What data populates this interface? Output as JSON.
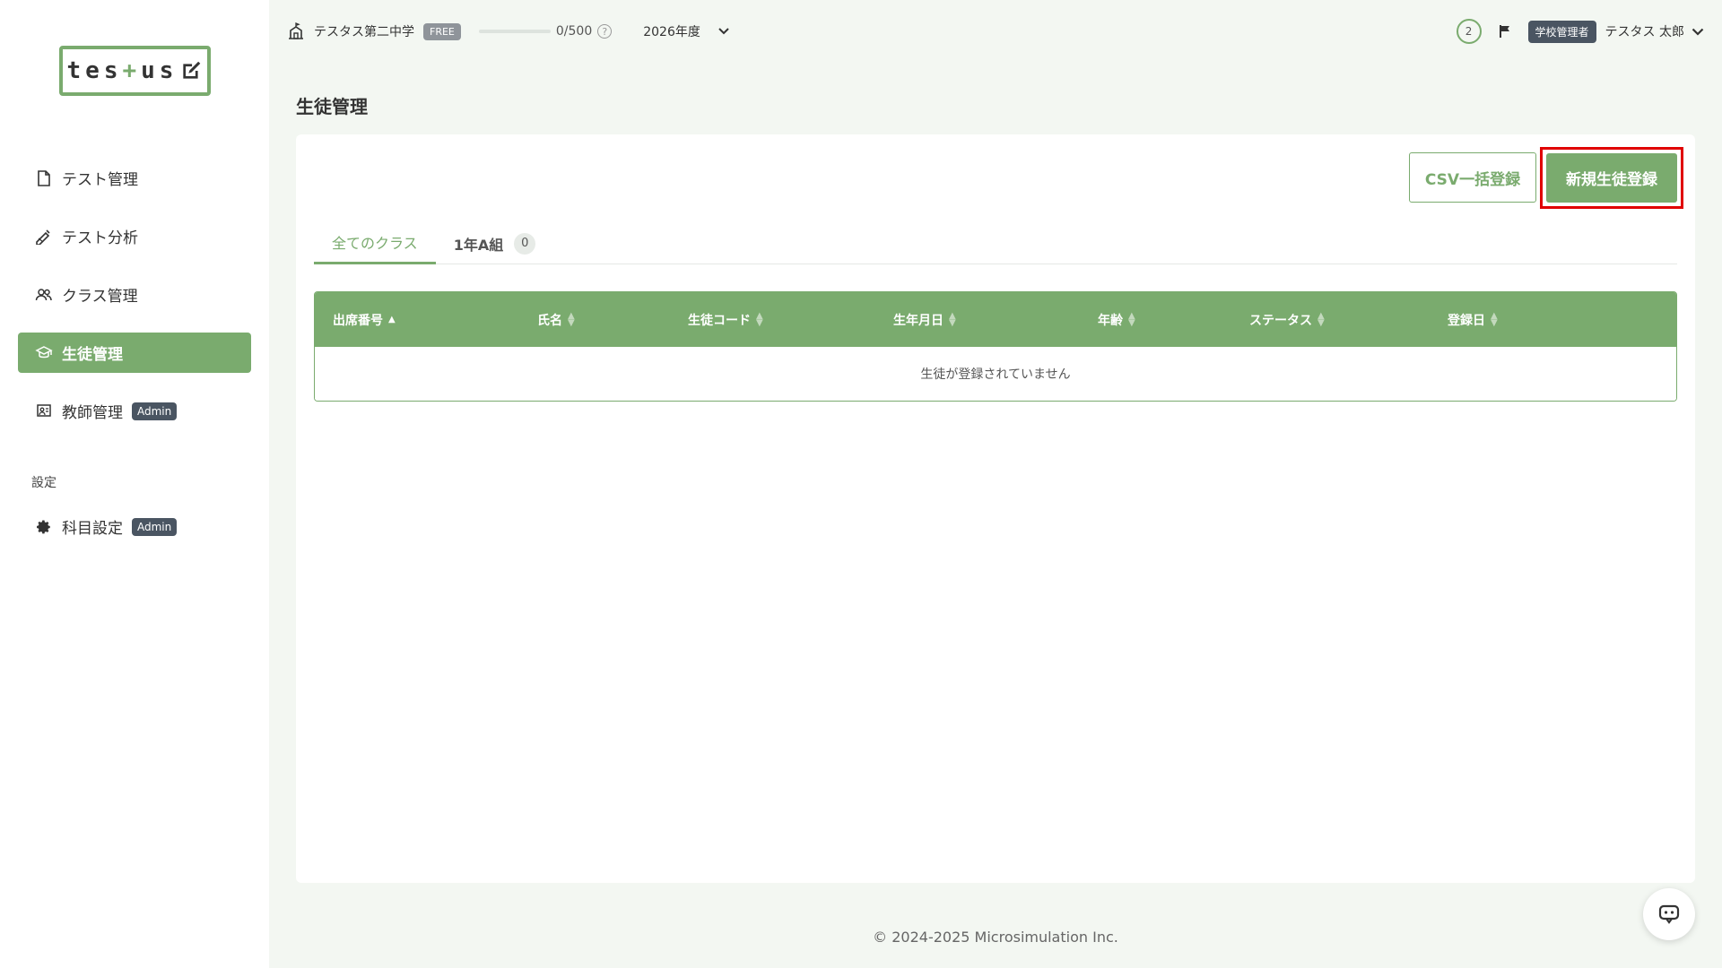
{
  "logo": {
    "pre": "tes",
    "plus": "+",
    "post": "us"
  },
  "sidebar": {
    "items": [
      {
        "label": "テスト管理",
        "icon": "document-icon"
      },
      {
        "label": "テスト分析",
        "icon": "pen-chart-icon"
      },
      {
        "label": "クラス管理",
        "icon": "users-icon"
      },
      {
        "label": "生徒管理",
        "icon": "graduation-cap-icon",
        "active": true
      },
      {
        "label": "教師管理",
        "icon": "teacher-board-icon",
        "badge": "Admin"
      }
    ],
    "section_label": "設定",
    "settings_items": [
      {
        "label": "科目設定",
        "icon": "gear-icon",
        "badge": "Admin"
      }
    ]
  },
  "header": {
    "school_name": "テスタス第二中学",
    "plan_badge": "FREE",
    "usage": {
      "used": 0,
      "limit": 500,
      "text": "0/500"
    },
    "help": "?",
    "year": "2026年度",
    "notification_count": "2",
    "role_badge": "学校管理者",
    "user_name": "テスタス 太郎"
  },
  "page": {
    "title": "生徒管理"
  },
  "toolbar": {
    "csv_label": "CSV一括登録",
    "new_label": "新規生徒登録"
  },
  "tabs": [
    {
      "label": "全てのクラス",
      "active": true
    },
    {
      "label": "1年A組",
      "count": "0"
    }
  ],
  "table": {
    "columns": [
      "出席番号",
      "氏名",
      "生徒コード",
      "生年月日",
      "年齢",
      "ステータス",
      "登録日"
    ],
    "empty_message": "生徒が登録されていません"
  },
  "footer": {
    "copyright": "© 2024-2025 Microsimulation Inc."
  },
  "colors": {
    "accent": "#7aab6e",
    "highlight": "#e00000",
    "badge_dark": "#4a5562"
  }
}
